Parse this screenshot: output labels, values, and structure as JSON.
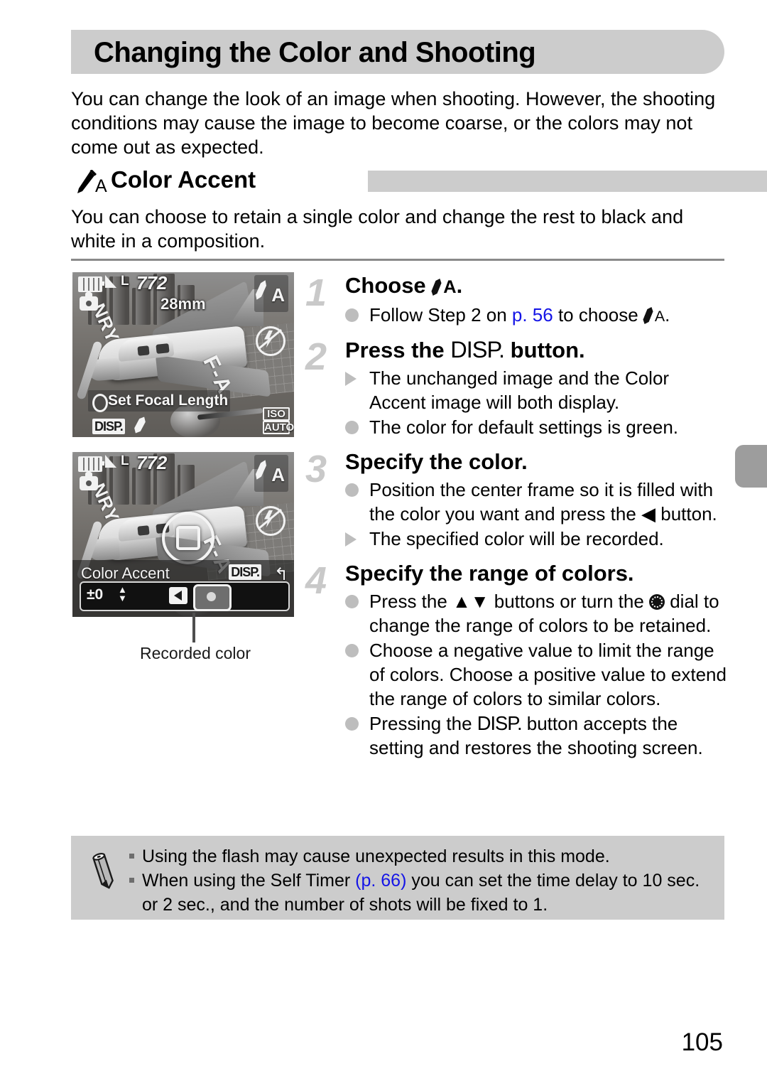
{
  "page": {
    "title": "Changing the Color and Shooting",
    "intro": "You can change the look of an image when shooting. However, the shooting conditions may cause the image to become coarse, or the colors may not come out as expected.",
    "page_number": "105"
  },
  "section": {
    "icon": "color-accent-dropper-icon",
    "icon_label": "A",
    "title": "Color Accent",
    "description": "You can choose to retain a single color and change the rest to black and white in a composition."
  },
  "figures": {
    "shot1": {
      "battery": "battery-icon",
      "quality": "L",
      "shots_remaining": "772",
      "focal_length": "28mm",
      "mode_badge": "A",
      "flash": "flash-off-icon",
      "hint": "Set Focal Length",
      "disp_key": "DISP.",
      "iso_line1": "ISO",
      "iso_line2": "AUTO"
    },
    "shot2": {
      "battery": "battery-icon",
      "quality": "L",
      "shots_remaining": "772",
      "mode_badge": "A",
      "flash": "flash-off-icon",
      "panel_title": "Color Accent",
      "disp_key": "DISP.",
      "back_arrow": "↰",
      "slider_value": "±0"
    },
    "callout": "Recorded color"
  },
  "steps": [
    {
      "number": "1",
      "head_pre": "Choose ",
      "head_icon": "color-accent-dropper-icon",
      "head_icon_label": "A",
      "head_post": ".",
      "bullets": [
        {
          "marker": "dot",
          "segments": [
            {
              "t": "Follow Step 2 on "
            },
            {
              "t": "p. 56",
              "link": true
            },
            {
              "t": " to choose "
            },
            {
              "icon": "color-accent-dropper-icon",
              "label": "A"
            },
            {
              "t": "."
            }
          ]
        }
      ]
    },
    {
      "number": "2",
      "head_pre": "Press the ",
      "head_icon": "disp-button-icon",
      "head_icon_label": "DISP.",
      "head_post": " button.",
      "bullets": [
        {
          "marker": "triangle",
          "segments": [
            {
              "t": "The unchanged image and the Color Accent image will both display."
            }
          ]
        },
        {
          "marker": "dot",
          "segments": [
            {
              "t": "The color for default settings is green."
            }
          ]
        }
      ]
    },
    {
      "number": "3",
      "head_pre": "Specify the color.",
      "head_icon": "",
      "head_icon_label": "",
      "head_post": "",
      "bullets": [
        {
          "marker": "dot",
          "segments": [
            {
              "t": "Position the center frame so it is filled with the color you want and press the "
            },
            {
              "icon": "left-arrow-button-icon",
              "label": "◀"
            },
            {
              "t": " button."
            }
          ]
        },
        {
          "marker": "triangle",
          "segments": [
            {
              "t": "The specified color will be recorded."
            }
          ]
        }
      ]
    },
    {
      "number": "4",
      "head_pre": "Specify the range of colors.",
      "head_icon": "",
      "head_icon_label": "",
      "head_post": "",
      "bullets": [
        {
          "marker": "dot",
          "segments": [
            {
              "t": "Press the "
            },
            {
              "icon": "up-down-buttons-icon",
              "label": "▲▼"
            },
            {
              "t": " buttons or turn the "
            },
            {
              "icon": "control-dial-icon",
              "label": ""
            },
            {
              "t": " dial to change the range of colors to be retained."
            }
          ]
        },
        {
          "marker": "dot",
          "segments": [
            {
              "t": "Choose a negative value to limit the range of colors. Choose a positive value to extend the range of colors to similar colors."
            }
          ]
        },
        {
          "marker": "dot",
          "segments": [
            {
              "t": "Pressing the "
            },
            {
              "icon": "disp-button-icon",
              "label": "DISP."
            },
            {
              "t": " button accepts the setting and restores the shooting screen."
            }
          ]
        }
      ]
    }
  ],
  "note": {
    "icon": "pencil-note-icon",
    "items": [
      {
        "segments": [
          {
            "t": "Using the flash may cause unexpected results in this mode."
          }
        ]
      },
      {
        "segments": [
          {
            "t": "When using the Self Timer "
          },
          {
            "t": "(p. 66)",
            "link": true
          },
          {
            "t": " you can set the time delay to 10 sec. or 2 sec., and the number of shots will be fixed to 1."
          }
        ]
      }
    ]
  },
  "colors": {
    "header_gray": "#cccccc",
    "link_blue": "#1414e6",
    "step_number_gray": "#c9c9c9",
    "bullet_gray": "#bdbdbd",
    "divider_gray": "#8a8a8a",
    "edge_tab_gray": "#9d9d9d"
  }
}
